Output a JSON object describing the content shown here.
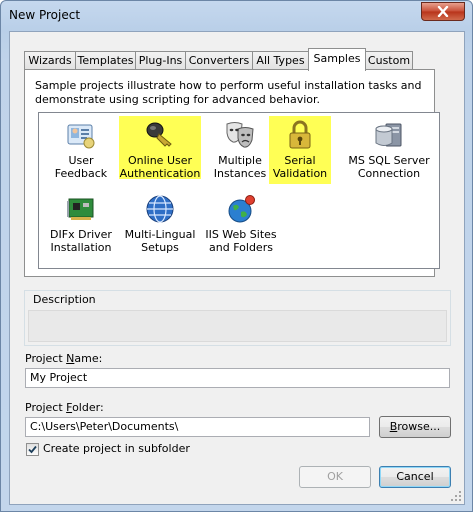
{
  "window": {
    "title": "New Project"
  },
  "tabs": [
    {
      "label": "Wizards"
    },
    {
      "label": "Templates"
    },
    {
      "label": "Plug-Ins"
    },
    {
      "label": "Converters"
    },
    {
      "label": "All Types"
    },
    {
      "label": "Samples",
      "active": true
    },
    {
      "label": "Custom"
    }
  ],
  "samples": {
    "description": "Sample projects illustrate how to perform useful installation tasks and demonstrate using scripting for advanced behavior.",
    "items": [
      {
        "label": "User Feedback",
        "icon": "user-card-icon"
      },
      {
        "label": "Online User Authentication",
        "icon": "key-icon",
        "highlighted": true
      },
      {
        "label": "Multiple Instances",
        "icon": "theater-masks-icon"
      },
      {
        "label": "Serial Validation",
        "icon": "padlock-icon",
        "highlighted": true
      },
      {
        "label": "MS SQL Server Connection",
        "icon": "database-server-icon"
      },
      {
        "label": "DIFx Driver Installation",
        "icon": "circuit-board-icon"
      },
      {
        "label": "Multi-Lingual Setups",
        "icon": "globe-icon"
      },
      {
        "label": "IIS Web Sites and Folders",
        "icon": "web-globe-icon"
      }
    ]
  },
  "description_group": {
    "label": "Description"
  },
  "project_name": {
    "label_pre": "Project ",
    "label_u": "N",
    "label_post": "ame:",
    "value": "My Project"
  },
  "project_folder": {
    "label_pre": "Project ",
    "label_u": "F",
    "label_post": "older:",
    "value": "C:\\Users\\Peter\\Documents\\"
  },
  "browse_button": {
    "label_u": "B",
    "label_post": "rowse..."
  },
  "create_subfolder": {
    "label": "Create project in subfolder",
    "checked": true
  },
  "ok_button": {
    "label": "OK",
    "enabled": false
  },
  "cancel_button": {
    "label": "Cancel"
  },
  "colors": {
    "highlight": "#ffff55",
    "close_red": "#c74d35"
  }
}
